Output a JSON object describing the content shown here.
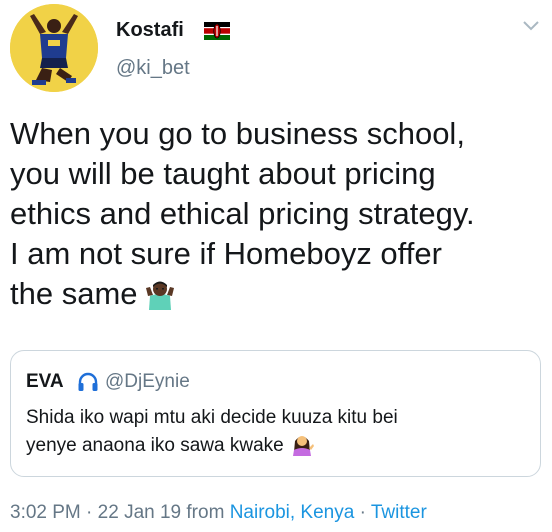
{
  "author": {
    "display_name": "Kostafi",
    "handle": "@ki_bet",
    "flag_icon": "kenya-flag-icon",
    "avatar_icon": "avatar-footballer-icon"
  },
  "tweet": {
    "lines": [
      "When you go to business school,",
      "you will be taught about pricing",
      "ethics and ethical pricing strategy.",
      "I am not sure if Homeboyz offer",
      "the same"
    ],
    "emoji": "man-shrugging-emoji"
  },
  "quoted": {
    "name": "EVA",
    "icon": "headphones-icon",
    "handle": "@DjEynie",
    "lines": [
      "Shida iko wapi mtu aki decide kuuza kitu bei",
      "yenye anaona iko sawa kwake"
    ],
    "emoji": "woman-tipping-hand-emoji"
  },
  "meta": {
    "time": "3:02 PM",
    "date": "22 Jan 19",
    "from": "from",
    "location": "Nairobi, Kenya",
    "separator": "·",
    "source": "Twitter"
  },
  "colors": {
    "text": "#14171a",
    "secondary": "#657786",
    "link": "#1b95e0",
    "border": "#ccd6dd",
    "avatar_bg": "#f1d247"
  }
}
